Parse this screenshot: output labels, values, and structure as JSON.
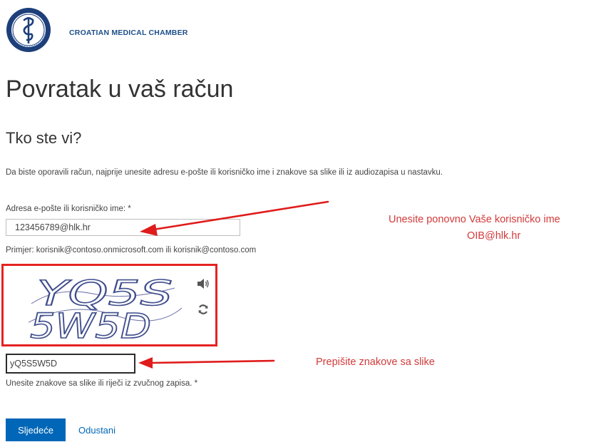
{
  "header": {
    "org_name": "CROATIAN MEDICAL CHAMBER",
    "logo_icon": "caduceus-seal-icon"
  },
  "page_title": "Povratak u vaš račun",
  "section_title": "Tko ste vi?",
  "instructions": "Da biste oporavili račun, najprije unesite adresu e-pošte ili korisničko ime i znakove sa slike ili iz audiozapisa u nastavku.",
  "email": {
    "label": "Adresa e-pošte ili korisničko ime: *",
    "value": "123456789@hlk.hr",
    "hint": "Primjer: korisnik@contoso.onmicrosoft.com ili korisnik@contoso.com"
  },
  "captcha": {
    "image_line1": "YQ5S",
    "image_line2": "5W5D",
    "audio_icon": "speaker-icon",
    "refresh_icon": "refresh-icon",
    "value": "yQ5S5W5D",
    "hint": "Unesite znakove sa slike ili riječi iz zvučnog zapisa. *"
  },
  "buttons": {
    "next": "Sljedeće",
    "cancel": "Odustani"
  },
  "annotations": {
    "username_line1": "Unesite ponovno Vaše korisničko ime",
    "username_line2": "OIB@hlk.hr",
    "captcha_note": "Prepišite znakove sa slike"
  },
  "colors": {
    "primary": "#0067b8",
    "annotation_red": "#e52222",
    "brand_navy": "#1d4e8a"
  }
}
